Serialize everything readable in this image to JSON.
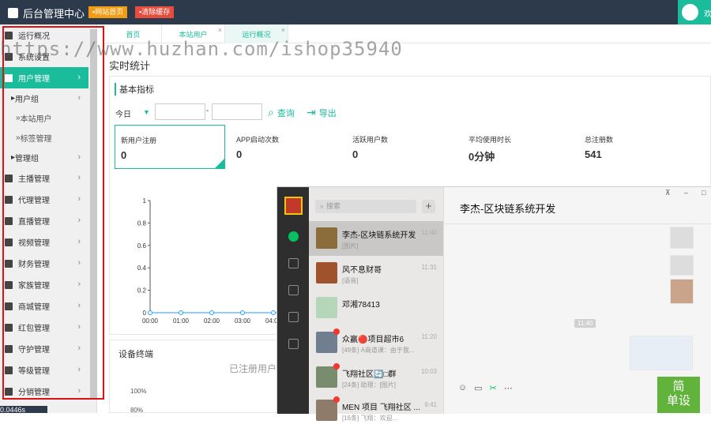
{
  "topbar": {
    "title": "后台管理中心",
    "home_button": "网站首页",
    "clear_cache_button": "清除缓存",
    "welcome": "欢"
  },
  "sidebar": {
    "items": [
      {
        "label": "运行概况",
        "icon": "bar-chart-icon",
        "chevron": ""
      },
      {
        "label": "系统设置",
        "icon": "gear-icon",
        "chevron": ""
      },
      {
        "label": "用户管理",
        "icon": "users-icon",
        "chevron": "›"
      },
      {
        "label": "用户组",
        "icon": "caret-right-icon",
        "chevron": "›"
      },
      {
        "label": "本站用户",
        "icon": "",
        "chevron": ""
      },
      {
        "label": "标签管理",
        "icon": "",
        "chevron": ""
      },
      {
        "label": "管理组",
        "icon": "caret-right-icon",
        "chevron": "›"
      },
      {
        "label": "主播管理",
        "icon": "badge-icon",
        "chevron": "›"
      },
      {
        "label": "代理管理",
        "icon": "monitor-icon",
        "chevron": "›"
      },
      {
        "label": "直播管理",
        "icon": "monitor-icon",
        "chevron": "›"
      },
      {
        "label": "视频管理",
        "icon": "video-icon",
        "chevron": "›"
      },
      {
        "label": "财务管理",
        "icon": "yen-icon",
        "chevron": "›"
      },
      {
        "label": "家族管理",
        "icon": "bank-icon",
        "chevron": "›"
      },
      {
        "label": "商城管理",
        "icon": "cart-icon",
        "chevron": "›"
      },
      {
        "label": "红包管理",
        "icon": "envelope-icon",
        "chevron": "›"
      },
      {
        "label": "守护管理",
        "icon": "shield-icon",
        "chevron": "›"
      },
      {
        "label": "等级管理",
        "icon": "level-up-icon",
        "chevron": "›"
      },
      {
        "label": "分销管理",
        "icon": "sitemap-icon",
        "chevron": "›"
      }
    ],
    "footer": "0.0446s"
  },
  "tabs": [
    {
      "label": "首页",
      "close": ""
    },
    {
      "label": "本站用户",
      "close": "×"
    },
    {
      "label": "运行概况",
      "close": "×"
    }
  ],
  "watermark": "https://www.huzhan.com/ishop35940",
  "page": {
    "title": "实时统计",
    "basic_panel_title": "基本指标",
    "filter_label": "今日",
    "date_separator": "-",
    "query_label": "查询",
    "export_label": "导出",
    "metrics": [
      {
        "label": "新用户注册",
        "value": "0"
      },
      {
        "label": "APP启动次数",
        "value": "0"
      },
      {
        "label": "活跃用户数",
        "value": "0"
      },
      {
        "label": "平均使用时长",
        "value": "0分钟"
      },
      {
        "label": "总注册数",
        "value": "541"
      }
    ],
    "device_panel_title": "设备终端",
    "device_empty": "已注册用户",
    "device_axis_labels": [
      "100%",
      "80%"
    ]
  },
  "chart_data": {
    "type": "line",
    "title": "",
    "xlabel": "",
    "ylabel": "",
    "x": [
      "00:00",
      "01:00",
      "02:00",
      "03:00",
      "04:00"
    ],
    "y_ticks": [
      "1",
      "0.8",
      "0.6",
      "0.4",
      "0.2",
      "0"
    ],
    "ylim": [
      0,
      1
    ],
    "series": [
      {
        "values": [
          0,
          0,
          0,
          0,
          0
        ]
      }
    ],
    "grid": true,
    "accent": "#1e9fff"
  },
  "chat": {
    "search_placeholder": "搜索",
    "plus": "+",
    "header_title": "李杰-区块链系统开发",
    "window_buttons": [
      "⊼",
      "–",
      "□"
    ],
    "time_stamp": "11:40",
    "conversations": [
      {
        "name": "李杰-区块链系统开发",
        "msg": "[图片]",
        "time": "11:40",
        "badge": false
      },
      {
        "name": "风不息财哥",
        "msg": "[语音]",
        "time": "11:31",
        "badge": false
      },
      {
        "name": "邓湘78413",
        "msg": "",
        "time": "",
        "badge": false
      },
      {
        "name": "众赢🔴项目超市6",
        "msg": "[49条] A商道课：由于我...",
        "time": "11:20",
        "badge": true
      },
      {
        "name": "飞翔社区🔄□群",
        "msg": "[24条] 助理：[图片]",
        "time": "10:03",
        "badge": true
      },
      {
        "name": "MEN 项目 飞翔社区 ...",
        "msg": "[16条] 飞翔：欢迎...",
        "time": "9:41",
        "badge": true
      }
    ],
    "toolbar_icons": [
      "smile-icon",
      "folder-icon",
      "scissors-icon",
      "chat-bubble-icon"
    ],
    "toolbar_glyphs": [
      "☺",
      "▭",
      "✂",
      "⋯"
    ]
  },
  "corner_badge": {
    "line1": "简",
    "line2": "单设"
  },
  "colors": {
    "accent": "#1abc9c",
    "topbar": "#2d3a4b",
    "highlight_box": "#e01010"
  }
}
